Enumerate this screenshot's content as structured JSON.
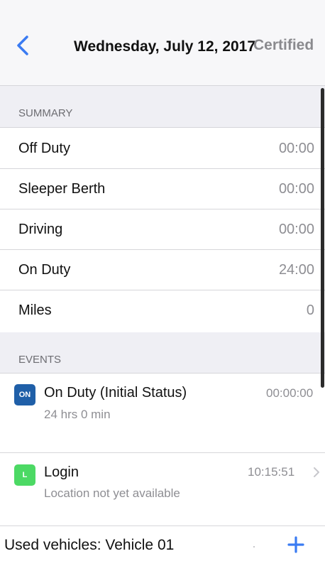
{
  "header": {
    "date": "Wednesday, July 12, 2017",
    "status": "Certified"
  },
  "summary": {
    "heading": "SUMMARY",
    "rows": [
      {
        "label": "Off Duty",
        "value": "00:00"
      },
      {
        "label": "Sleeper Berth",
        "value": "00:00"
      },
      {
        "label": "Driving",
        "value": "00:00"
      },
      {
        "label": "On Duty",
        "value": "24:00"
      },
      {
        "label": "Miles",
        "value": "0"
      }
    ]
  },
  "events": {
    "heading": "EVENTS",
    "items": [
      {
        "badge": "ON",
        "badge_color": "#1f5fa8",
        "title": "On Duty (Initial Status)",
        "subtitle": "24 hrs 0 min",
        "time": "00:00:00"
      },
      {
        "badge": "L",
        "badge_color": "#4cd964",
        "title": "Login",
        "subtitle": "Location not yet available",
        "time": "10:15:51"
      }
    ]
  },
  "footer": {
    "label": "Used vehicles: Vehicle 01"
  },
  "colors": {
    "accent": "#3a7bf2"
  }
}
